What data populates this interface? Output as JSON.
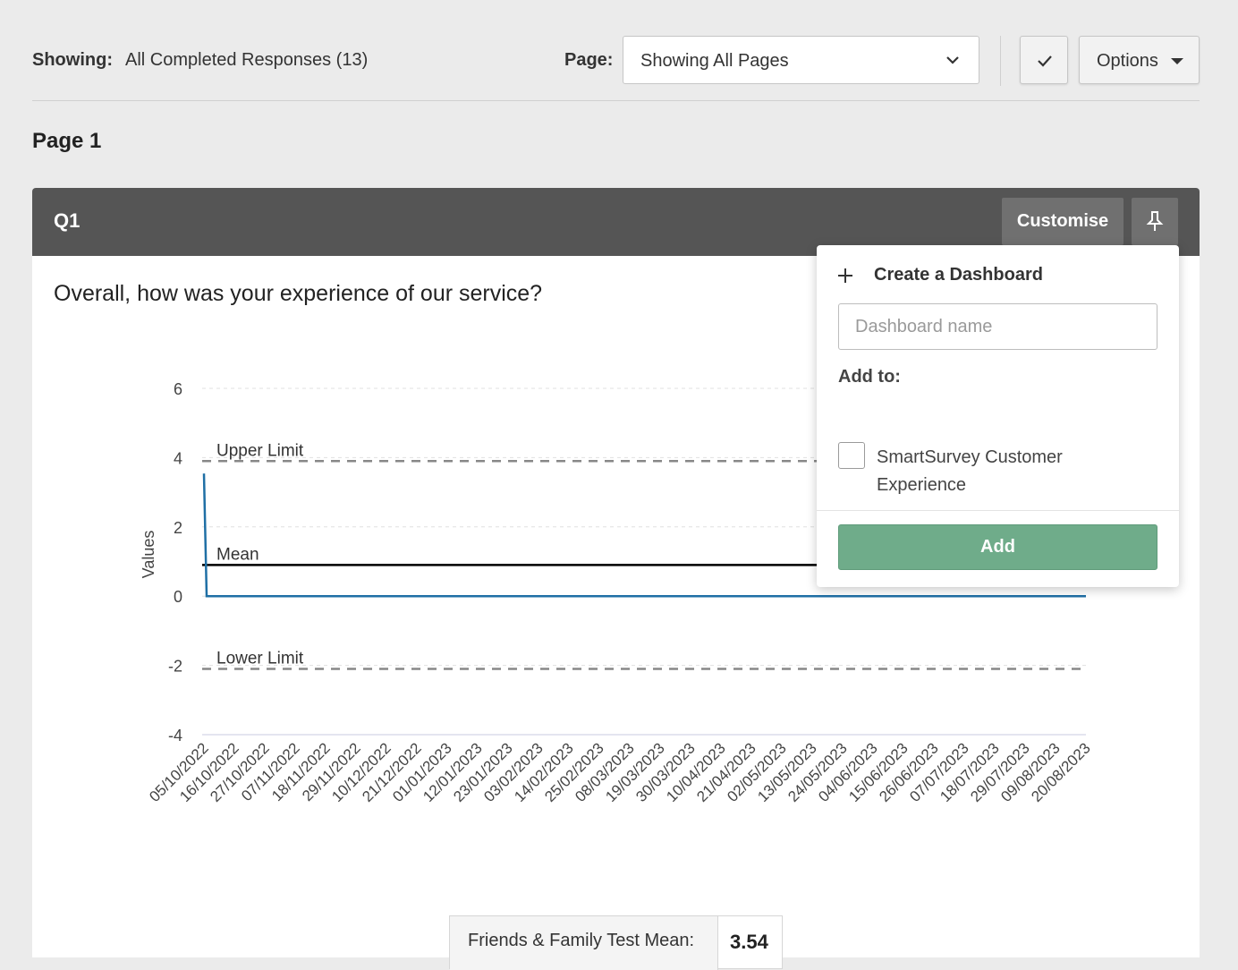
{
  "topbar": {
    "showing_label": "Showing:",
    "showing_value": "All Completed Responses (13)",
    "page_label": "Page:",
    "page_select_value": "Showing All Pages",
    "options_label": "Options"
  },
  "page_heading": "Page 1",
  "panel": {
    "question_number": "Q1",
    "customise_label": "Customise",
    "question_text": "Overall, how was your experience of our service?"
  },
  "popup": {
    "create_label": "Create a Dashboard",
    "dashboard_name_placeholder": "Dashboard name",
    "add_to_label": "Add to:",
    "dashboard_option": "SmartSurvey Customer Experience",
    "add_button": "Add"
  },
  "mean_summary": {
    "label": "Friends & Family Test Mean:",
    "value": "3.54"
  },
  "colors": {
    "header_bg": "#555555",
    "series_line": "#1f6fa5",
    "mean_line": "#000000",
    "limit_line": "#888888",
    "add_button": "#6fac8a"
  },
  "chart_data": {
    "type": "line",
    "ylabel": "Values",
    "ylim": [
      -4,
      6
    ],
    "yticks": [
      "6",
      "4",
      "2",
      "0",
      "-2",
      "-4"
    ],
    "categories": [
      "05/10/2022",
      "16/10/2022",
      "27/10/2022",
      "07/11/2022",
      "18/11/2022",
      "29/11/2022",
      "10/12/2022",
      "21/12/2022",
      "01/01/2023",
      "12/01/2023",
      "23/01/2023",
      "03/02/2023",
      "14/02/2023",
      "25/02/2023",
      "08/03/2023",
      "19/03/2023",
      "30/03/2023",
      "10/04/2023",
      "21/04/2023",
      "02/05/2023",
      "13/05/2023",
      "24/05/2023",
      "04/06/2023",
      "15/06/2023",
      "26/06/2023",
      "07/07/2023",
      "18/07/2023",
      "29/07/2023",
      "09/08/2023",
      "20/08/2023"
    ],
    "series": [
      {
        "values": [
          3.54,
          0,
          0,
          0,
          0,
          0,
          0,
          0,
          0,
          0,
          0,
          0,
          0,
          0,
          0,
          0,
          0,
          0,
          0,
          0,
          0,
          0,
          0,
          0,
          0,
          0,
          0,
          0,
          0,
          0
        ]
      }
    ],
    "reference_lines": [
      {
        "label": "Upper Limit",
        "value": 3.9,
        "style": "dashed"
      },
      {
        "label": "Mean",
        "value": 0.9,
        "style": "solid"
      },
      {
        "label": "Lower Limit",
        "value": -2.1,
        "style": "dashed"
      }
    ],
    "grid": true
  }
}
